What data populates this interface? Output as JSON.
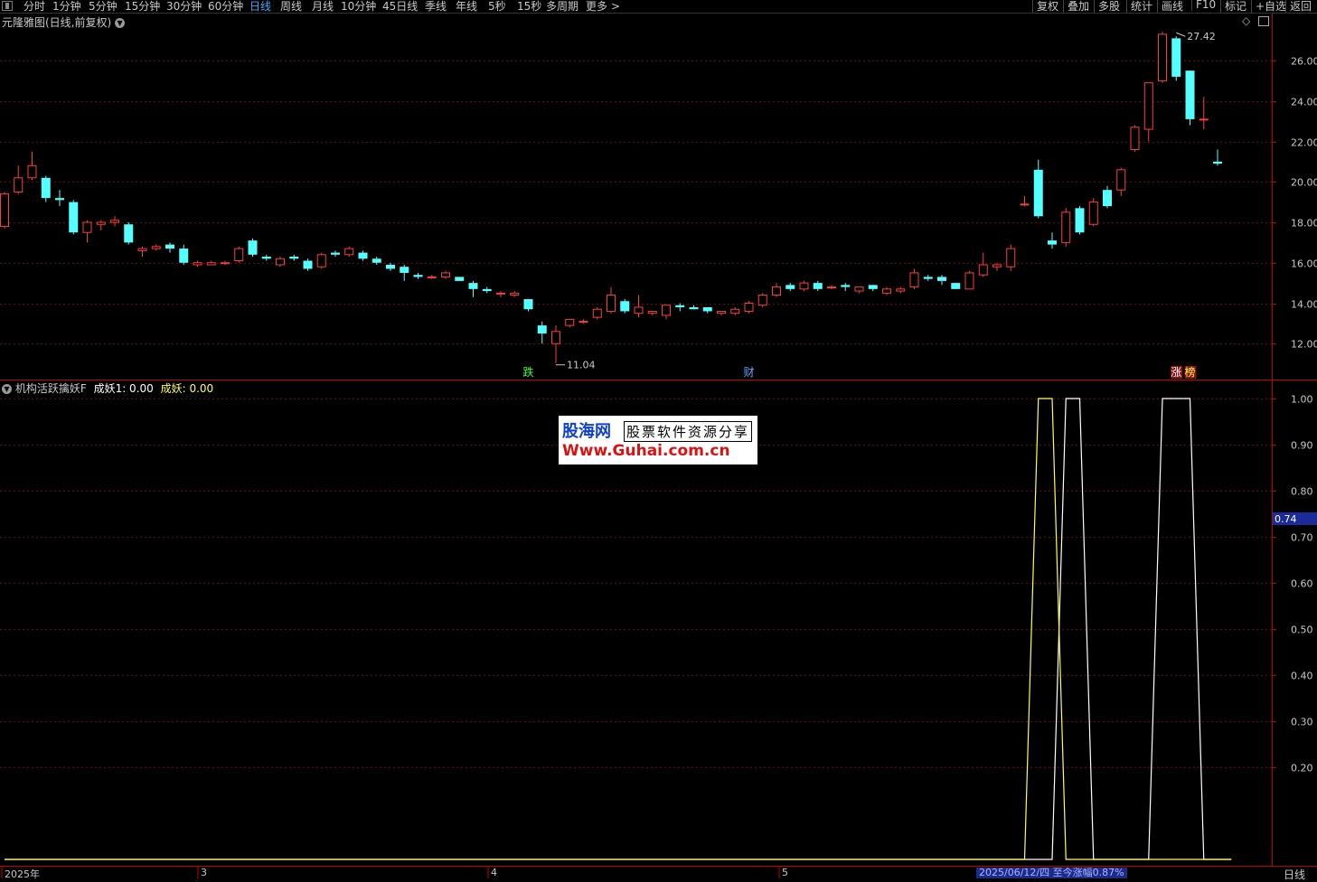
{
  "toolbar": {
    "items": [
      "分时",
      "1分钟",
      "5分钟",
      "15分钟",
      "30分钟",
      "60分钟",
      "日线",
      "周线",
      "月线",
      "10分钟",
      "45日线",
      "季线",
      "年线",
      "5秒",
      "15秒",
      "多周期",
      "更多 >"
    ],
    "active_index": 6,
    "right_items": [
      "复权",
      "叠加",
      "多股",
      "统计",
      "画线",
      "F10",
      "标记",
      "+自选",
      "返回"
    ]
  },
  "main_panel": {
    "title": "元隆雅图(日线,前复权)",
    "dropdown_icon": "chevron-down-icon",
    "right_icons": [
      "diamond-icon",
      "window-toggle-icon"
    ]
  },
  "indicator_panel": {
    "title": "机构活跃擒妖F",
    "line1_label": "成妖1: 0.00",
    "line2_label": "成妖: 0.00",
    "line2_color": "#ffff50"
  },
  "watermark": {
    "brand": "股海网",
    "slogan": "股票软件资源分享",
    "url": "Www.Guhai.com.cn"
  },
  "x_axis": {
    "labels": [
      "2025年",
      "3",
      "4",
      "5"
    ],
    "status": "2025/06/12/四 至今涨幅0.87%",
    "right_label": "日线"
  },
  "colors": {
    "up": "#ff3c3c",
    "down": "#54ffff",
    "grid": "#7a0000",
    "axis": "#c00000",
    "line1": "#ffffff",
    "line2": "#ffff50"
  },
  "chart_data": [
    {
      "type": "candlestick",
      "y_ticks": [
        "12.00",
        "14.00",
        "16.00",
        "18.00",
        "20.00",
        "22.00",
        "24.00",
        "26.00"
      ],
      "ylim": [
        11.0,
        27.5
      ],
      "annotations": {
        "low": "11.04",
        "high": "27.42"
      },
      "markers": [
        {
          "index": 38,
          "text": "跌",
          "color": "#40ff40"
        },
        {
          "index": 54,
          "text": "财",
          "color": "#5fa8ff"
        },
        {
          "index": 85,
          "text": "涨",
          "color": "#ffffff",
          "bg": "#8a1010"
        },
        {
          "index": 86,
          "text": "榜",
          "color": "#ffff40",
          "bg": "#8a1010"
        }
      ],
      "candles": [
        [
          17.8,
          19.5,
          17.7,
          19.4
        ],
        [
          19.5,
          20.8,
          19.4,
          20.2
        ],
        [
          20.2,
          21.5,
          20.1,
          20.8
        ],
        [
          20.2,
          20.3,
          19.0,
          19.2
        ],
        [
          19.2,
          19.6,
          18.8,
          19.1
        ],
        [
          19.0,
          19.1,
          17.4,
          17.5
        ],
        [
          17.5,
          18.1,
          17.0,
          18.0
        ],
        [
          17.9,
          18.1,
          17.6,
          18.0
        ],
        [
          18.0,
          18.3,
          17.8,
          18.1
        ],
        [
          17.9,
          18.0,
          16.9,
          17.0
        ],
        [
          16.6,
          16.8,
          16.3,
          16.7
        ],
        [
          16.7,
          16.9,
          16.6,
          16.8
        ],
        [
          16.9,
          17.0,
          16.5,
          16.7
        ],
        [
          16.7,
          16.9,
          15.9,
          16.0
        ],
        [
          15.9,
          16.1,
          15.8,
          16.0
        ],
        [
          15.9,
          16.1,
          15.9,
          16.0
        ],
        [
          16.0,
          16.1,
          15.9,
          16.0
        ],
        [
          16.1,
          16.8,
          16.0,
          16.7
        ],
        [
          17.1,
          17.2,
          16.3,
          16.4
        ],
        [
          16.3,
          16.4,
          16.1,
          16.2
        ],
        [
          15.9,
          16.3,
          15.8,
          16.2
        ],
        [
          16.3,
          16.4,
          16.1,
          16.2
        ],
        [
          16.1,
          16.2,
          15.6,
          15.7
        ],
        [
          15.8,
          16.5,
          15.7,
          16.4
        ],
        [
          16.5,
          16.6,
          16.3,
          16.4
        ],
        [
          16.4,
          16.8,
          16.3,
          16.7
        ],
        [
          16.5,
          16.6,
          16.1,
          16.2
        ],
        [
          16.2,
          16.3,
          15.9,
          16.0
        ],
        [
          15.9,
          16.0,
          15.6,
          15.7
        ],
        [
          15.8,
          15.9,
          15.1,
          15.5
        ],
        [
          15.4,
          15.5,
          15.2,
          15.3
        ],
        [
          15.3,
          15.4,
          15.2,
          15.3
        ],
        [
          15.3,
          15.6,
          15.2,
          15.5
        ],
        [
          15.3,
          15.3,
          15.1,
          15.1
        ],
        [
          15.0,
          15.1,
          14.3,
          14.7
        ],
        [
          14.7,
          14.8,
          14.5,
          14.6
        ],
        [
          14.5,
          14.6,
          14.3,
          14.5
        ],
        [
          14.4,
          14.6,
          14.3,
          14.5
        ],
        [
          14.2,
          14.2,
          13.6,
          13.7
        ],
        [
          12.9,
          13.1,
          12.0,
          12.5
        ],
        [
          12.0,
          12.9,
          11.04,
          12.6
        ],
        [
          12.9,
          13.2,
          12.8,
          13.2
        ],
        [
          13.1,
          13.2,
          13.0,
          13.1
        ],
        [
          13.3,
          13.8,
          13.2,
          13.7
        ],
        [
          13.6,
          14.8,
          13.5,
          14.4
        ],
        [
          14.1,
          14.2,
          13.5,
          13.6
        ],
        [
          13.5,
          14.4,
          13.3,
          13.8
        ],
        [
          13.5,
          13.6,
          13.4,
          13.6
        ],
        [
          13.4,
          13.9,
          13.2,
          13.9
        ],
        [
          13.9,
          14.0,
          13.6,
          13.8
        ],
        [
          13.8,
          13.9,
          13.7,
          13.7
        ],
        [
          13.8,
          13.8,
          13.5,
          13.6
        ],
        [
          13.5,
          13.6,
          13.4,
          13.6
        ],
        [
          13.5,
          13.8,
          13.4,
          13.7
        ],
        [
          13.6,
          14.1,
          13.5,
          14.0
        ],
        [
          13.9,
          14.5,
          13.8,
          14.4
        ],
        [
          14.4,
          15.0,
          14.3,
          14.8
        ],
        [
          14.9,
          15.0,
          14.6,
          14.7
        ],
        [
          14.7,
          15.1,
          14.6,
          15.0
        ],
        [
          15.0,
          15.1,
          14.6,
          14.7
        ],
        [
          14.8,
          14.9,
          14.7,
          14.8
        ],
        [
          14.9,
          15.0,
          14.6,
          14.8
        ],
        [
          14.6,
          14.8,
          14.5,
          14.8
        ],
        [
          14.9,
          14.9,
          14.6,
          14.7
        ],
        [
          14.5,
          14.8,
          14.4,
          14.7
        ],
        [
          14.6,
          14.8,
          14.5,
          14.7
        ],
        [
          14.8,
          15.7,
          14.7,
          15.5
        ],
        [
          15.3,
          15.4,
          15.1,
          15.2
        ],
        [
          15.3,
          15.4,
          14.9,
          15.1
        ],
        [
          15.0,
          15.0,
          14.7,
          14.7
        ],
        [
          14.7,
          15.6,
          14.7,
          15.5
        ],
        [
          15.4,
          16.5,
          15.3,
          15.9
        ],
        [
          15.8,
          16.0,
          15.6,
          15.9
        ],
        [
          15.8,
          16.9,
          15.6,
          16.7
        ],
        [
          18.9,
          19.3,
          18.8,
          18.9
        ],
        [
          20.6,
          21.1,
          18.2,
          18.3
        ],
        [
          17.1,
          17.5,
          16.7,
          16.9
        ],
        [
          17.0,
          18.7,
          16.8,
          18.5
        ],
        [
          18.7,
          18.8,
          17.4,
          17.5
        ],
        [
          17.9,
          19.2,
          17.8,
          19.0
        ],
        [
          19.6,
          19.8,
          18.7,
          18.8
        ],
        [
          19.6,
          20.7,
          19.3,
          20.6
        ],
        [
          21.6,
          22.8,
          21.5,
          22.7
        ],
        [
          22.6,
          24.9,
          22.0,
          24.9
        ],
        [
          25.0,
          27.42,
          24.9,
          27.3
        ],
        [
          27.1,
          27.2,
          25.0,
          25.2
        ],
        [
          25.5,
          25.5,
          22.8,
          23.1
        ],
        [
          23.1,
          24.2,
          22.6,
          23.1
        ],
        [
          21.0,
          21.6,
          20.8,
          20.9
        ]
      ]
    },
    {
      "type": "line",
      "y_ticks": [
        "0.20",
        "0.30",
        "0.40",
        "0.50",
        "0.60",
        "0.70",
        "0.80",
        "0.90",
        "1.00"
      ],
      "ylim": [
        0,
        1.0
      ],
      "current_value": "0.74",
      "series": [
        {
          "name": "成妖1",
          "color": "#ffffff",
          "points": [
            [
              0,
              0
            ],
            [
              76,
              0
            ],
            [
              77,
              1
            ],
            [
              78,
              1
            ],
            [
              79,
              0
            ],
            [
              83,
              0
            ],
            [
              84,
              1
            ],
            [
              85,
              1
            ],
            [
              86,
              1
            ],
            [
              87,
              0
            ],
            [
              89,
              0
            ]
          ]
        },
        {
          "name": "成妖",
          "color": "#ffff50",
          "points": [
            [
              0,
              0
            ],
            [
              74,
              0
            ],
            [
              75,
              1
            ],
            [
              76,
              1
            ],
            [
              77,
              0
            ],
            [
              89,
              0
            ]
          ]
        }
      ]
    }
  ]
}
